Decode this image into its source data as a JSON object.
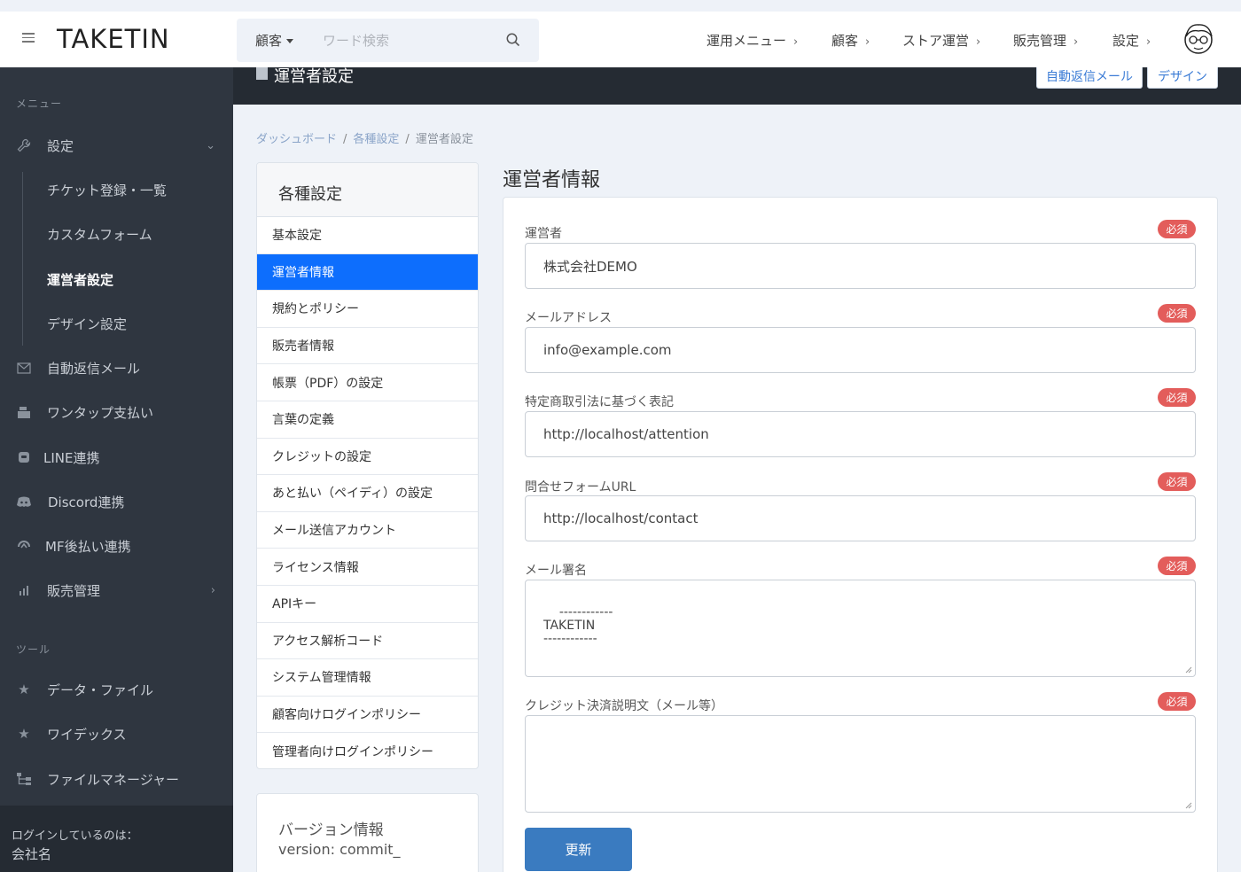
{
  "header": {
    "logo": "TAKETIN",
    "search": {
      "scope": "顧客",
      "placeholder": "ワード検索"
    },
    "nav": [
      {
        "label": "運用メニュー"
      },
      {
        "label": "顧客"
      },
      {
        "label": "ストア運営"
      },
      {
        "label": "販売管理"
      },
      {
        "label": "設定"
      }
    ]
  },
  "sidebar": {
    "section_menu": "メニュー",
    "settings": "設定",
    "settings_sub": [
      "チケット登録・一覧",
      "カスタムフォーム",
      "運営者設定",
      "デザイン設定"
    ],
    "items": [
      "自動返信メール",
      "ワンタップ支払い",
      "LINE連携",
      "Discord連携",
      "MF後払い連携",
      "販売管理"
    ],
    "section_tools": "ツール",
    "tools": [
      "データ・ファイル",
      "ワイデックス",
      "ファイルマネージャー"
    ],
    "footer_label": "ログインしているのは：",
    "footer_name": "会社名"
  },
  "pagebar": {
    "title": "運営者設定",
    "btn_mail": "自動返信メール",
    "btn_design": "デザイン"
  },
  "breadcrumb": {
    "home": "ダッシュボード",
    "parent": "各種設定",
    "current": "運営者設定"
  },
  "settings_list": {
    "title": "各種設定",
    "items": [
      "基本設定",
      "運営者情報",
      "規約とポリシー",
      "販売者情報",
      "帳票（PDF）の設定",
      "言葉の定義",
      "クレジットの設定",
      "あと払い（ペイディ）の設定",
      "メール送信アカウント",
      "ライセンス情報",
      "APIキー",
      "アクセス解析コード",
      "システム管理情報",
      "顧客向けログインポリシー",
      "管理者向けログインポリシー"
    ],
    "active_index": 1
  },
  "version": {
    "title": "バージョン情報",
    "value": "version: commit_"
  },
  "form": {
    "title": "運営者情報",
    "required_label": "必須",
    "operator_label": "運営者",
    "operator_value": "株式会社DEMO",
    "email_label": "メールアドレス",
    "email_value": "info@example.com",
    "tokusho_label": "特定商取引法に基づく表記",
    "tokusho_value": "http://localhost/attention",
    "contact_label": "問合せフォームURL",
    "contact_value": "http://localhost/contact",
    "signature_label": "メール署名",
    "signature_value": "------------\nTAKETIN\n------------",
    "credit_label": "クレジット決済説明文（メール等）",
    "credit_value": "",
    "submit": "更新"
  },
  "colors": {
    "active": "#0d6efd",
    "required": "#e35d5b",
    "sidebar": "#2f3640",
    "submit": "#3a7bc0"
  }
}
